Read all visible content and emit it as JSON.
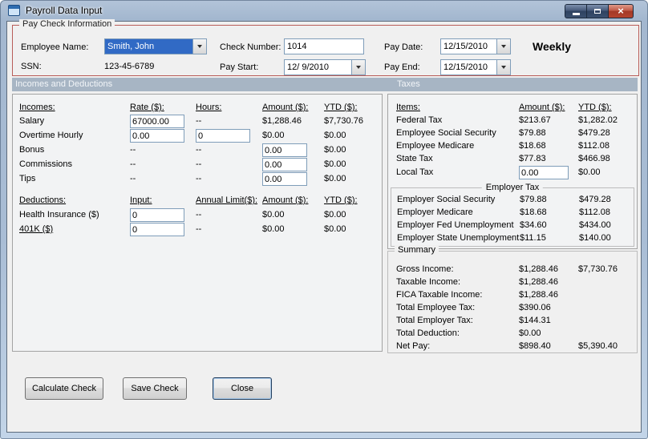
{
  "window": {
    "title": "Payroll Data Input"
  },
  "paycheck": {
    "title": "Pay Check Information",
    "employee_name_label": "Employee Name:",
    "employee_name": "Smith, John",
    "ssn_label": "SSN:",
    "ssn": "123-45-6789",
    "check_number_label": "Check Number:",
    "check_number": "1014",
    "pay_start_label": "Pay Start:",
    "pay_start": "12/ 9/2010",
    "pay_date_label": "Pay Date:",
    "pay_date": "12/15/2010",
    "pay_end_label": "Pay End:",
    "pay_end": "12/15/2010",
    "frequency": "Weekly"
  },
  "sections": {
    "left": "Incomes and Deductions",
    "right": "Taxes"
  },
  "incomes": {
    "h_name": "Incomes:",
    "h_rate": "Rate ($):",
    "h_hours": "Hours:",
    "h_amount": "Amount ($):",
    "h_ytd": "YTD ($):",
    "salary": {
      "name": "Salary",
      "rate": "67000.00",
      "hours": "--",
      "amount": "$1,288.46",
      "ytd": "$7,730.76"
    },
    "overtime": {
      "name": "Overtime Hourly",
      "rate": "0.00",
      "hours": "0",
      "amount": "$0.00",
      "ytd": "$0.00"
    },
    "bonus": {
      "name": "Bonus",
      "rate": "--",
      "hours": "--",
      "amount": "0.00",
      "ytd": "$0.00"
    },
    "commissions": {
      "name": "Commissions",
      "rate": "--",
      "hours": "--",
      "amount": "0.00",
      "ytd": "$0.00"
    },
    "tips": {
      "name": "Tips",
      "rate": "--",
      "hours": "--",
      "amount": "0.00",
      "ytd": "$0.00"
    }
  },
  "deductions": {
    "h_name": "Deductions:",
    "h_input": "Input:",
    "h_limit": "Annual Limit($):",
    "h_amount": "Amount ($):",
    "h_ytd": "YTD ($):",
    "health": {
      "name": "Health Insurance ($)",
      "input": "0",
      "limit": "--",
      "amount": "$0.00",
      "ytd": "$0.00"
    },
    "k401": {
      "name": "401K ($)",
      "input": "0",
      "limit": "--",
      "amount": "$0.00",
      "ytd": "$0.00"
    }
  },
  "taxes": {
    "h_items": "Items:",
    "h_amount": "Amount ($):",
    "h_ytd": "YTD ($):",
    "rows": [
      {
        "name": "Federal Tax",
        "amount": "$213.67",
        "ytd": "$1,282.02"
      },
      {
        "name": "Employee Social Security",
        "amount": "$79.88",
        "ytd": "$479.28"
      },
      {
        "name": "Employee Medicare",
        "amount": "$18.68",
        "ytd": "$112.08"
      },
      {
        "name": "State Tax",
        "amount": "$77.83",
        "ytd": "$466.98"
      }
    ],
    "local": {
      "name": "Local Tax",
      "amount": "0.00",
      "ytd": "$0.00"
    },
    "employer_title": "Employer Tax",
    "employer_rows": [
      {
        "name": "Employer Social Security",
        "amount": "$79.88",
        "ytd": "$479.28"
      },
      {
        "name": "Employer Medicare",
        "amount": "$18.68",
        "ytd": "$112.08"
      },
      {
        "name": "Employer Fed Unemployment",
        "amount": "$34.60",
        "ytd": "$434.00"
      },
      {
        "name": "Employer State Unemployment",
        "amount": "$11.15",
        "ytd": "$140.00"
      }
    ]
  },
  "summary": {
    "title": "Summary",
    "rows": [
      {
        "label": "Gross Income:",
        "amount": "$1,288.46",
        "ytd": "$7,730.76"
      },
      {
        "label": "Taxable Income:",
        "amount": "$1,288.46",
        "ytd": ""
      },
      {
        "label": "FICA Taxable Income:",
        "amount": "$1,288.46",
        "ytd": ""
      },
      {
        "label": "Total Employee Tax:",
        "amount": "$390.06",
        "ytd": ""
      },
      {
        "label": "Total Employer Tax:",
        "amount": "$144.31",
        "ytd": ""
      },
      {
        "label": "Total Deduction:",
        "amount": "$0.00",
        "ytd": ""
      },
      {
        "label": "Net Pay:",
        "amount": "$898.40",
        "ytd": "$5,390.40"
      }
    ]
  },
  "buttons": {
    "calculate": "Calculate Check",
    "save": "Save Check",
    "close": "Close"
  },
  "colors": {
    "selection": "#316ac5",
    "paycheck_border": "#b85c58",
    "section_bar": "#a7b5c4",
    "close_button": "#b4432e"
  }
}
